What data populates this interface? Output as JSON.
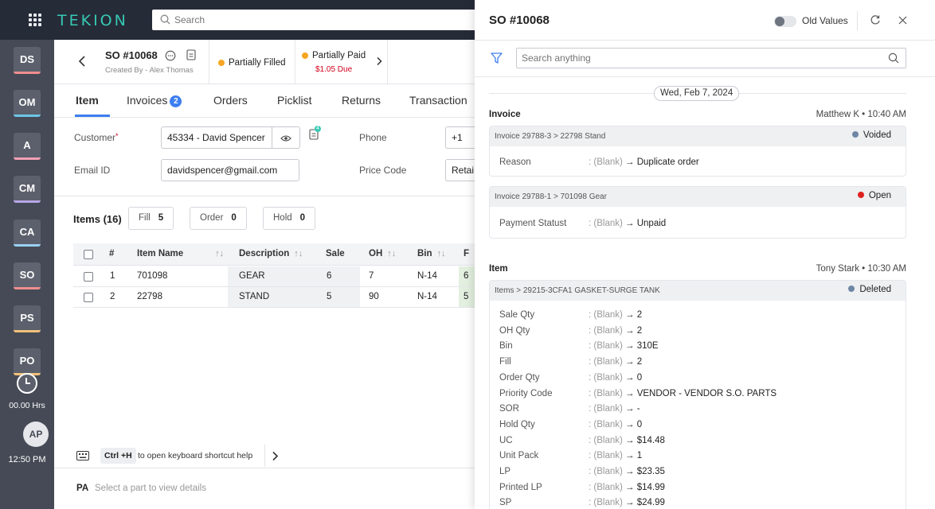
{
  "topbar": {
    "logo": "TEKION",
    "search_placeholder": "Search"
  },
  "rail": {
    "items": [
      {
        "label": "DS",
        "color": "#ef8e8e"
      },
      {
        "label": "OM",
        "color": "#6ec6e6"
      },
      {
        "label": "A",
        "color": "#f2a0b6"
      },
      {
        "label": "CM",
        "color": "#b6a6e6"
      },
      {
        "label": "CA",
        "color": "#9ad0f2"
      },
      {
        "label": "SO",
        "color": "#ef8e8e"
      },
      {
        "label": "PS",
        "color": "#f2c07a"
      },
      {
        "label": "PO",
        "color": "#f2c07a"
      }
    ],
    "hours": "00.00 Hrs",
    "avatar": "AP",
    "time": "12:50 PM"
  },
  "header": {
    "so_number": "SO #10068",
    "created_by": "Created By - Alex Thomas",
    "fill_status": "Partially Filled",
    "pay_status": "Partially Paid",
    "due": "$1.05 Due"
  },
  "tabs": [
    {
      "label": "Item"
    },
    {
      "label": "Invoices",
      "count": "2"
    },
    {
      "label": "Orders"
    },
    {
      "label": "Picklist"
    },
    {
      "label": "Returns"
    },
    {
      "label": "Transaction"
    }
  ],
  "form": {
    "customer_label": "Customer",
    "customer_value": "45334 - David Spencer",
    "notes_count": "4",
    "phone_label": "Phone",
    "phone_value": "+1",
    "email_label": "Email ID",
    "email_value": "davidspencer@gmail.com",
    "price_code_label": "Price Code",
    "price_code_value": "Retai"
  },
  "items": {
    "title": "Items (16)",
    "fill_label": "Fill",
    "fill_value": "5",
    "order_label": "Order",
    "order_value": "0",
    "hold_label": "Hold",
    "hold_value": "0"
  },
  "table": {
    "headers": [
      "#",
      "Item Name",
      "Description",
      "Sale",
      "OH",
      "Bin",
      "F"
    ],
    "rows": [
      {
        "num": "1",
        "name": "701098",
        "desc": "GEAR",
        "sale": "6",
        "oh": "7",
        "bin": "N-14",
        "f": "6"
      },
      {
        "num": "2",
        "name": "22798",
        "desc": "STAND",
        "sale": "5",
        "oh": "90",
        "bin": "N-14",
        "f": "5"
      }
    ]
  },
  "shortcut": {
    "key": "Ctrl +H",
    "text": "to open keyboard shortcut help"
  },
  "bottom": {
    "label": "PA",
    "text": "Select a part to view details"
  },
  "drawer": {
    "title": "SO #10068",
    "toggle_label": "Old Values",
    "search_placeholder": "Search anything",
    "date": "Wed, Feb 7, 2024",
    "invoice": {
      "title": "Invoice",
      "meta": "Matthew K • 10:40 AM",
      "cards": [
        {
          "path": "Invoice 29788-3 > 22798 Stand",
          "status": "Voided",
          "status_color": "#6f87a6",
          "field": "Reason",
          "old": ": (Blank)",
          "new": "Duplicate order"
        },
        {
          "path": "Invoice 29788-1 > 701098 Gear",
          "status": "Open",
          "status_color": "#e02020",
          "field": "Payment Statust",
          "old": ": (Blank)",
          "new": "Unpaid"
        }
      ]
    },
    "item": {
      "title": "Item",
      "meta": "Tony Stark • 10:30 AM",
      "path": "Items > 29215-3CFA1 GASKET-SURGE TANK",
      "status": "Deleted",
      "status_color": "#6f87a6",
      "old": ": (Blank)",
      "fields": [
        {
          "k": "Sale Qty",
          "v": "2"
        },
        {
          "k": "OH Qty",
          "v": "2"
        },
        {
          "k": "Bin",
          "v": "310E"
        },
        {
          "k": "Fill",
          "v": "2"
        },
        {
          "k": "Order Qty",
          "v": "0"
        },
        {
          "k": "Priority Code",
          "v": "VENDOR - VENDOR S.O. PARTS"
        },
        {
          "k": "SOR",
          "v": "-"
        },
        {
          "k": "Hold Qty",
          "v": "0"
        },
        {
          "k": "UC",
          "v": "$14.48"
        },
        {
          "k": "Unit Pack",
          "v": "1"
        },
        {
          "k": "LP",
          "v": "$23.35"
        },
        {
          "k": "Printed LP",
          "v": "$14.99"
        },
        {
          "k": "SP",
          "v": "$24.99"
        }
      ]
    }
  }
}
